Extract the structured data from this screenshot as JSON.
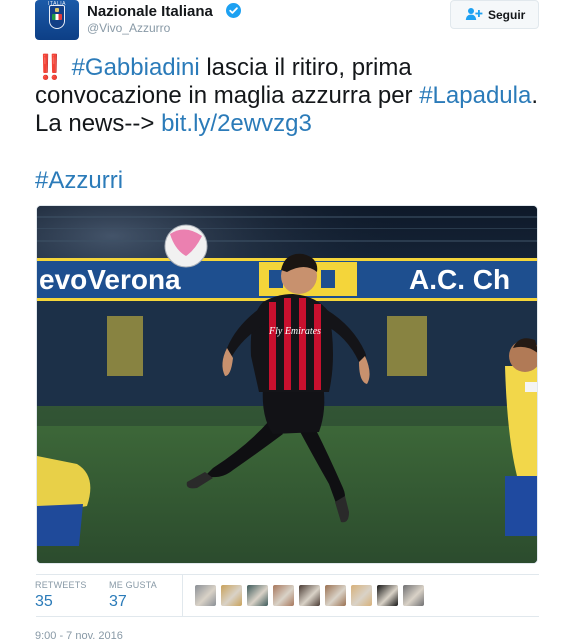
{
  "header": {
    "display_name": "Nazionale Italiana",
    "handle": "@Vivo_Azzurro",
    "avatar_text": "ITALIA",
    "verified_icon": "verified-badge-icon",
    "follow_label": "Seguir",
    "follow_icon": "add-user-icon"
  },
  "tweet": {
    "emoji": "‼️",
    "hashtag1": "#Gabbiadini",
    "text1": " lascia il ritiro, prima convocazione in maglia azzurra per ",
    "hashtag2": "#Lapadula",
    "text2": ". La news--> ",
    "link": "bit.ly/2ewvzg3",
    "hashtag3": "#Azzurri"
  },
  "photo": {
    "banner_left": "evoVerona",
    "banner_right": "A.C. Ch",
    "jersey_sponsor": "Fly Emirates"
  },
  "stats": {
    "retweets_label": "RETWEETS",
    "retweets_value": "35",
    "likes_label": "ME GUSTA",
    "likes_value": "37"
  },
  "likers": [
    {
      "name": "liker-avatar-1",
      "color": "#8a8f96"
    },
    {
      "name": "liker-avatar-2",
      "color": "#c9a25a"
    },
    {
      "name": "liker-avatar-3",
      "color": "#3d5a5a"
    },
    {
      "name": "liker-avatar-4",
      "color": "#a7775c"
    },
    {
      "name": "liker-avatar-5",
      "color": "#4a3b34"
    },
    {
      "name": "liker-avatar-6",
      "color": "#9a7152"
    },
    {
      "name": "liker-avatar-7",
      "color": "#d8b17a"
    },
    {
      "name": "liker-avatar-8",
      "color": "#151515"
    },
    {
      "name": "liker-avatar-9",
      "color": "#6f6f72"
    }
  ],
  "timestamp": "9:00 - 7 nov. 2016",
  "colors": {
    "link_blue": "#2b7bb9",
    "muted_gray": "#8899a6",
    "border": "#e1e8ed",
    "verified_blue": "#1da1f2"
  }
}
